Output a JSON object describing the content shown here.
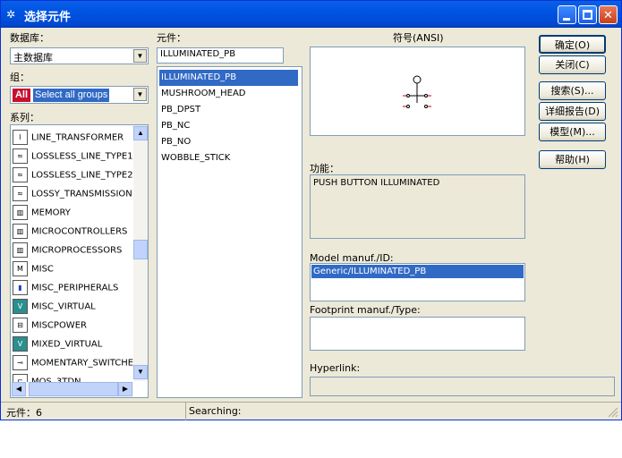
{
  "window": {
    "title": "选择元件"
  },
  "database": {
    "label": "数据库：",
    "value": "主数据库"
  },
  "group": {
    "label": "组：",
    "badge": "All",
    "value": "Select all groups"
  },
  "family": {
    "label": "系列：",
    "items": [
      {
        "label": "LINE_TRANSFORMER",
        "icon": "transformer-icon"
      },
      {
        "label": "LOSSLESS_LINE_TYPE1",
        "icon": "line-icon"
      },
      {
        "label": "LOSSLESS_LINE_TYPE2",
        "icon": "line-icon"
      },
      {
        "label": "LOSSY_TRANSMISSION",
        "icon": "line-icon"
      },
      {
        "label": "MEMORY",
        "icon": "chip-icon"
      },
      {
        "label": "MICROCONTROLLERS",
        "icon": "chip-icon"
      },
      {
        "label": "MICROPROCESSORS",
        "icon": "chip-icon"
      },
      {
        "label": "MISC",
        "icon": "misc-icon"
      },
      {
        "label": "MISC_PERIPHERALS",
        "icon": "peripheral-icon"
      },
      {
        "label": "MISC_VIRTUAL",
        "icon": "virtual-icon"
      },
      {
        "label": "MISCPOWER",
        "icon": "power-icon"
      },
      {
        "label": "MIXED_VIRTUAL",
        "icon": "virtual-icon"
      },
      {
        "label": "MOMENTARY_SWITCHE",
        "icon": "switch-icon"
      },
      {
        "label": "MOS_3TDN",
        "icon": "mos-icon"
      }
    ]
  },
  "component": {
    "label": "元件：",
    "value": "ILLUMINATED_PB",
    "items": [
      "ILLUMINATED_PB",
      "MUSHROOM_HEAD",
      "PB_DPST",
      "PB_NC",
      "PB_NO",
      "WOBBLE_STICK"
    ]
  },
  "symbol": {
    "label": "符号(ANSI)"
  },
  "function": {
    "label": "功能：",
    "value": "PUSH BUTTON ILLUMINATED"
  },
  "model": {
    "label": "Model manuf./ID:",
    "value": "Generic/ILLUMINATED_PB"
  },
  "footprint": {
    "label": "Footprint manuf./Type:",
    "value": ""
  },
  "hyperlink": {
    "label": "Hyperlink:",
    "value": ""
  },
  "buttons": {
    "ok": "确定(O)",
    "close": "关闭(C)",
    "search": "搜索(S)...",
    "report": "详细报告(D)",
    "model": "模型(M)...",
    "help": "帮助(H)"
  },
  "status": {
    "count": "元件：6",
    "searching": "Searching:"
  }
}
